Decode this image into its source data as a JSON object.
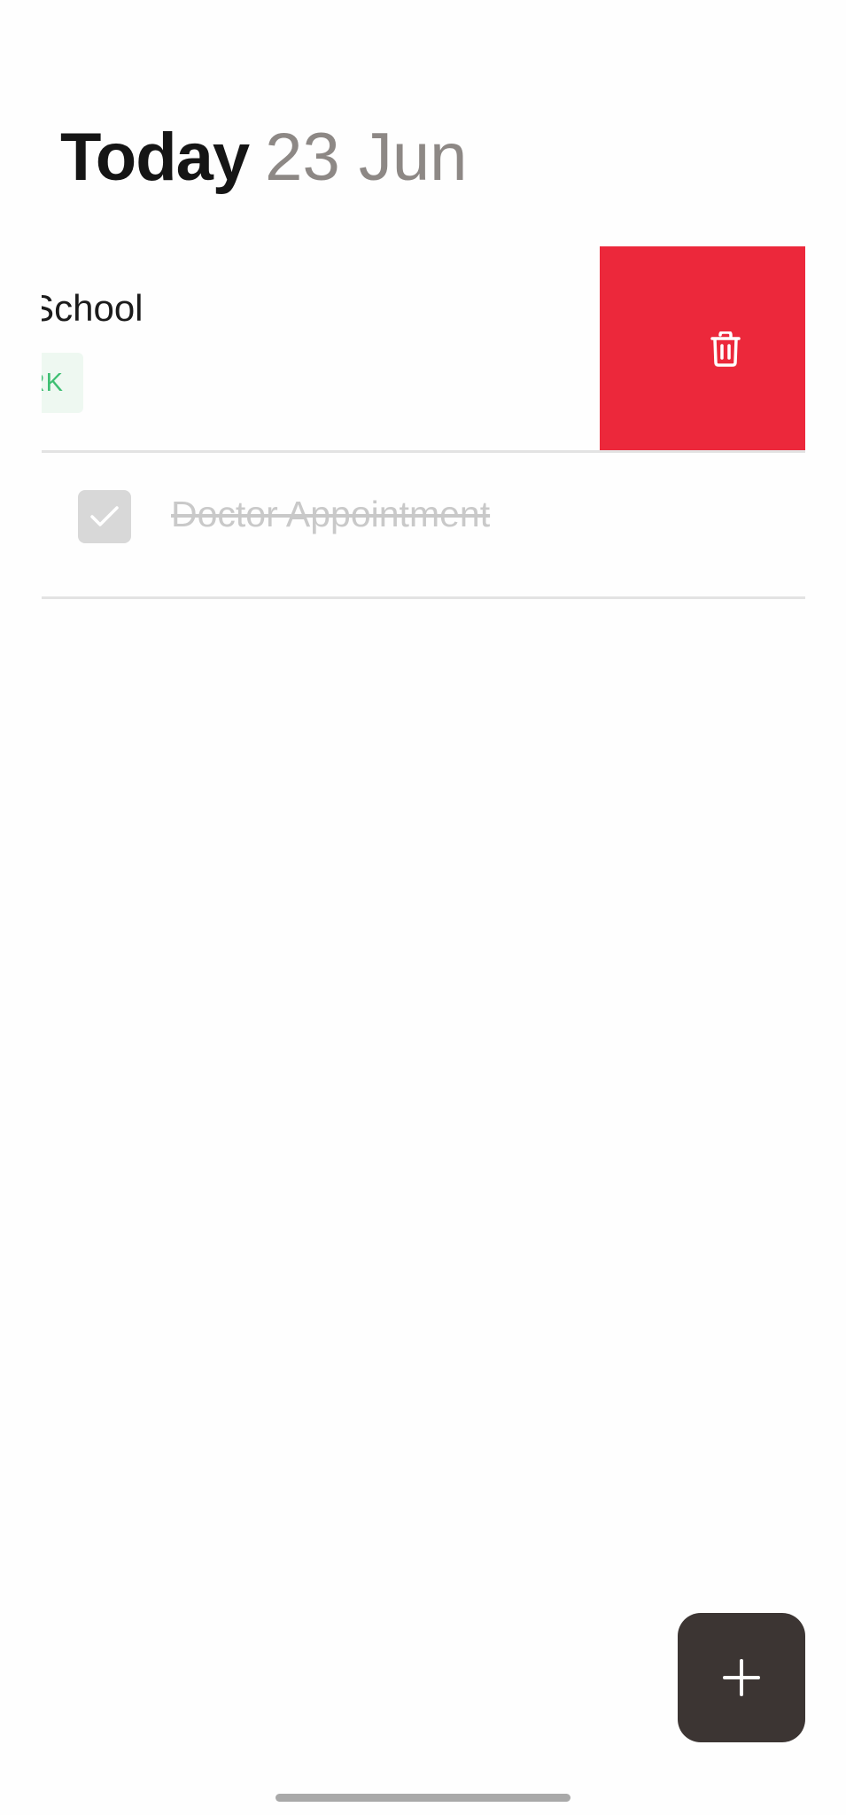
{
  "header": {
    "title": "Today",
    "date": "23 Jun"
  },
  "tasks": [
    {
      "title_visible": "ting at School",
      "tag_visible": "RK",
      "tag_color": "#3fbf73",
      "swipe_action": "delete",
      "swipe_action_color": "#ec283b",
      "completed": false
    },
    {
      "title": "Doctor Appointment",
      "completed": true
    }
  ],
  "icons": {
    "delete": "trash-icon",
    "check": "check-icon",
    "add": "plus-icon"
  },
  "colors": {
    "fab": "#3c3533",
    "date_gray": "#8d8885"
  }
}
